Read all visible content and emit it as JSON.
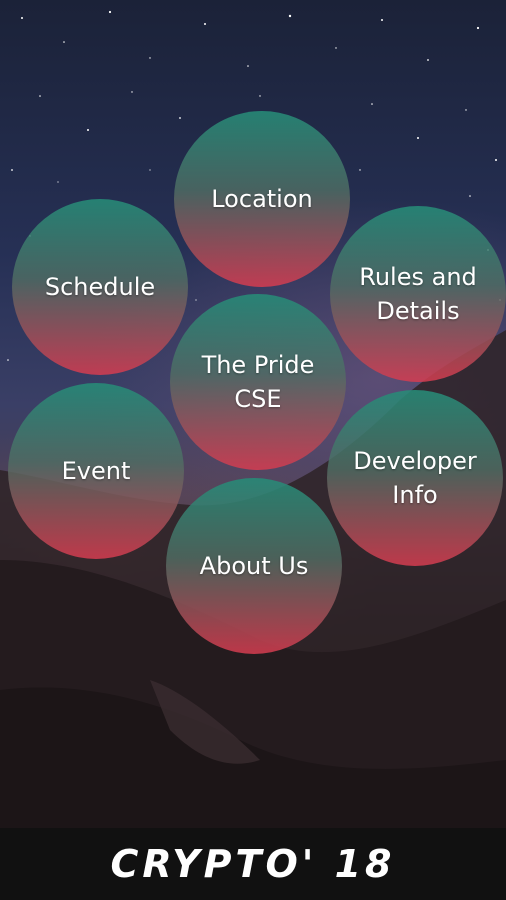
{
  "menu": {
    "location": "Location",
    "schedule": "Schedule",
    "rules_and_details": "Rules and\nDetails",
    "the_pride_cse": "The Pride\nCSE",
    "event": "Event",
    "developer_info": "Developer\nInfo",
    "about_us": "About Us"
  },
  "footer": {
    "title": "CRYPTO' 18"
  },
  "colors": {
    "bubble_top": "#268c78",
    "bubble_bottom": "#d73c50",
    "footer_bg": "#111111",
    "text": "#ffffff"
  }
}
